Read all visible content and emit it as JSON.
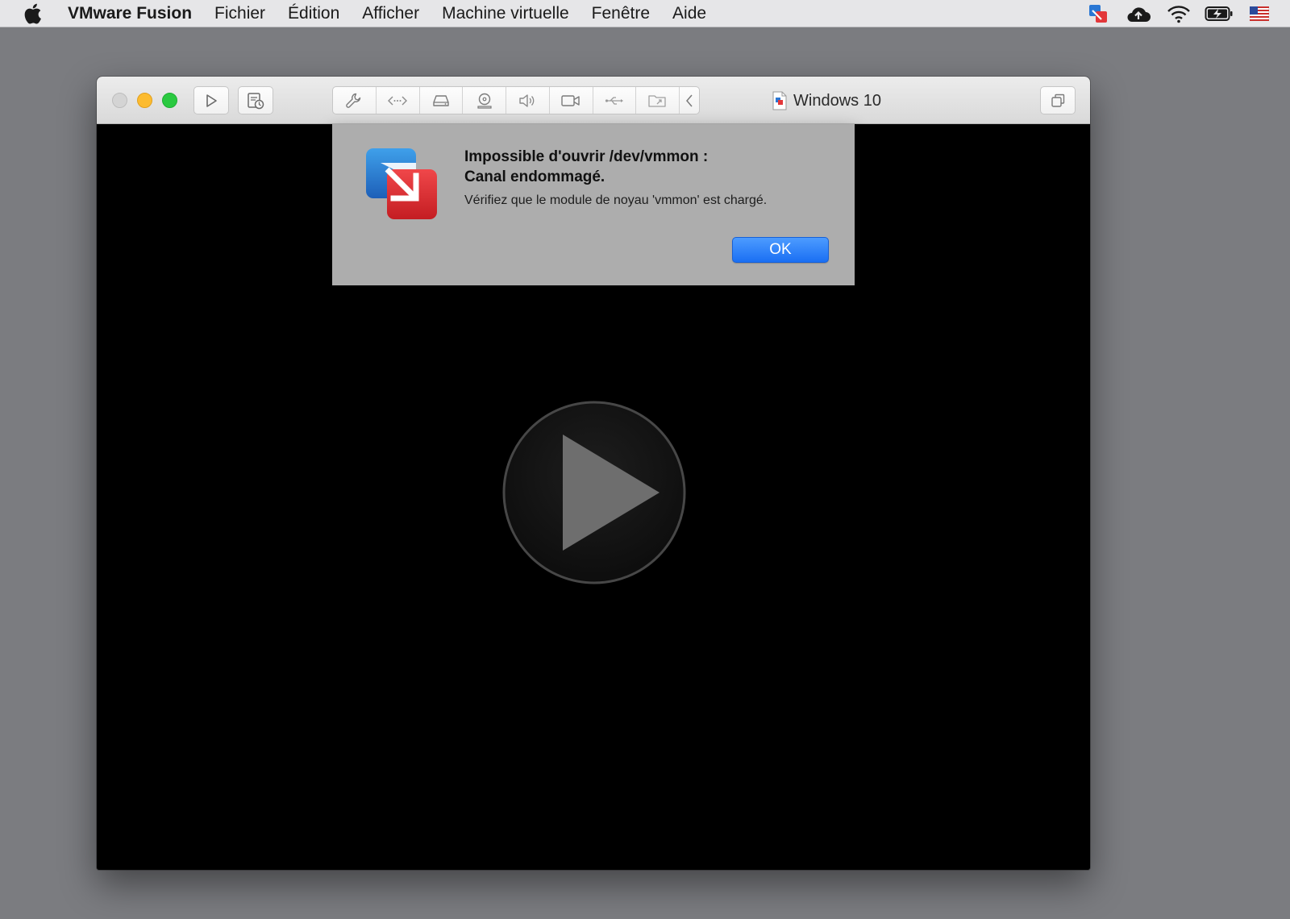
{
  "menubar": {
    "apple_icon": "apple-icon",
    "items": [
      {
        "label": "VMware Fusion"
      },
      {
        "label": "Fichier"
      },
      {
        "label": "Édition"
      },
      {
        "label": "Afficher"
      },
      {
        "label": "Machine virtuelle"
      },
      {
        "label": "Fenêtre"
      },
      {
        "label": "Aide"
      }
    ],
    "status_icons": [
      "vmware-fusion-status-icon",
      "cloud-upload-icon",
      "wifi-icon",
      "battery-charging-icon",
      "us-flag-icon"
    ]
  },
  "window": {
    "title": "Windows 10",
    "toolbar_icons": [
      "wrench-icon",
      "network-icon",
      "hard-disk-icon",
      "cd-dvd-icon",
      "sound-icon",
      "camera-icon",
      "usb-icon",
      "shared-folder-icon",
      "chevron-left-icon"
    ]
  },
  "alert": {
    "title_line1": "Impossible d'ouvrir /dev/vmmon :",
    "title_line2": "Canal endommagé.",
    "message": "Vérifiez que le module de noyau 'vmmon' est chargé.",
    "ok_label": "OK"
  },
  "colors": {
    "desktop": "#7b7c80",
    "accent_button": "#1a6ff3",
    "alert_background": "#adadad",
    "traffic_minimize": "#fcbb2f",
    "traffic_zoom": "#2ac940"
  }
}
